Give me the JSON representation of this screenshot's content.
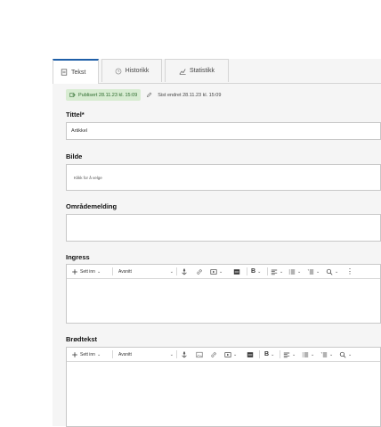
{
  "tabs": [
    {
      "label": "Tekst",
      "icon": "document-icon"
    },
    {
      "label": "Historikk",
      "icon": "clock-icon"
    },
    {
      "label": "Statistikk",
      "icon": "chart-icon"
    }
  ],
  "status": {
    "published": "Publisert 28.11.23 kl. 15:09",
    "last_edited": "Sist endret 28.11.23 kl. 15:09"
  },
  "fields": {
    "title_label": "Tittel*",
    "title_value": "Artikkel",
    "image_label": "Bilde",
    "image_placeholder": "Klikk for å velge",
    "area_label": "Områdemelding",
    "ingress_label": "Ingress",
    "body_label": "Brødtekst"
  },
  "toolbar": {
    "insert_label": "Sett inn",
    "paragraph_label": "Avsnitt",
    "bold_label": "B"
  },
  "colors": {
    "accent": "#1f5fa8",
    "published_bg": "#d8ecd2",
    "published_fg": "#2b6a2b"
  }
}
